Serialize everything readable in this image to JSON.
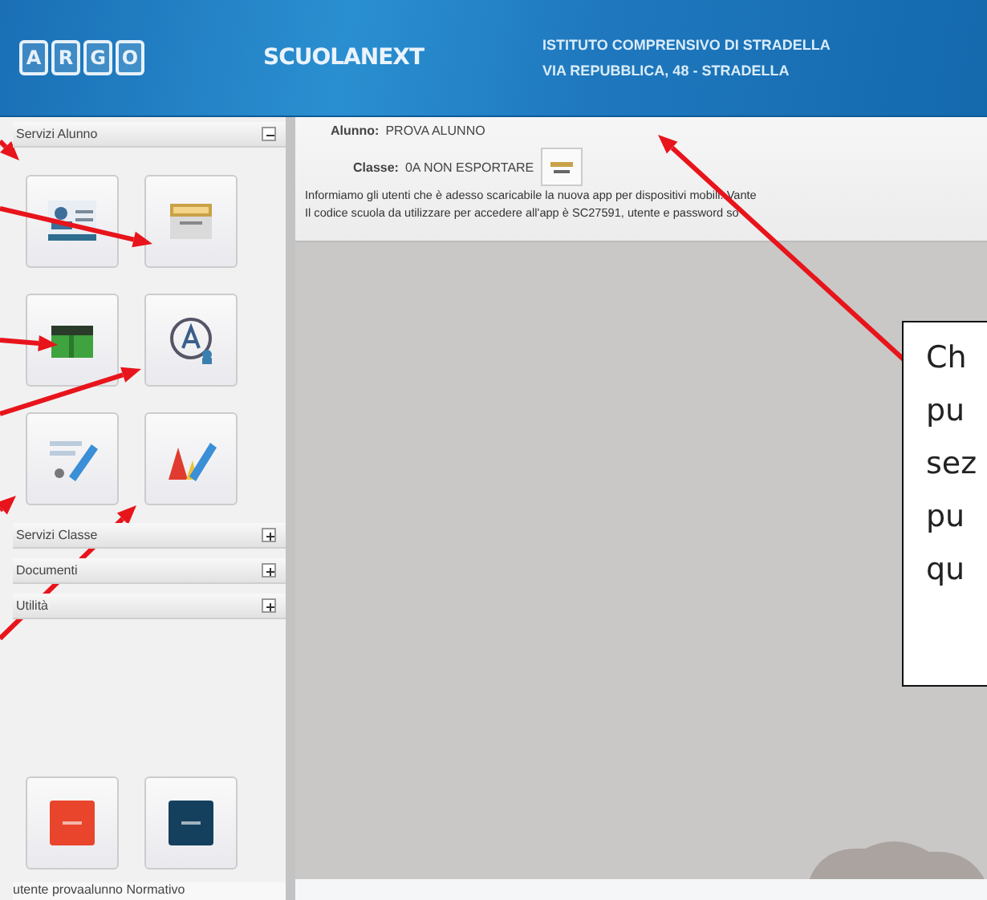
{
  "header": {
    "logo_letters": [
      "A",
      "R",
      "G",
      "O"
    ],
    "app_name": "SCUOLANEXT",
    "school_lines": [
      "ISTITUTO COMPRENSIVO DI STRADELLA",
      "VIA REPUBBLICA, 48 - STRADELLA"
    ]
  },
  "sidebar": {
    "sections": [
      {
        "title": "Servizi Alunno",
        "expanded": true
      },
      {
        "title": "Servizi Classe",
        "expanded": false
      },
      {
        "title": "Documenti",
        "expanded": false
      },
      {
        "title": "Utilità",
        "expanded": false
      }
    ],
    "user_line": "utente provaalunno Normativo"
  },
  "student_panel": {
    "fields": [
      {
        "label": "Alunno:",
        "value": "PROVA ALUNNO"
      },
      {
        "label": "Classe:",
        "value": "0A NON ESPORTARE"
      }
    ],
    "notice_lines": [
      "Informiamo gli utenti che è adesso scaricabile la nuova app per dispositivi mobili. Vante",
      "Il codice scuola da utilizzare per accedere all'app è SC27591, utente e password so"
    ]
  },
  "callout": {
    "lines": [
      "Ch",
      "pu",
      "sez",
      "pu",
      "qu"
    ]
  }
}
